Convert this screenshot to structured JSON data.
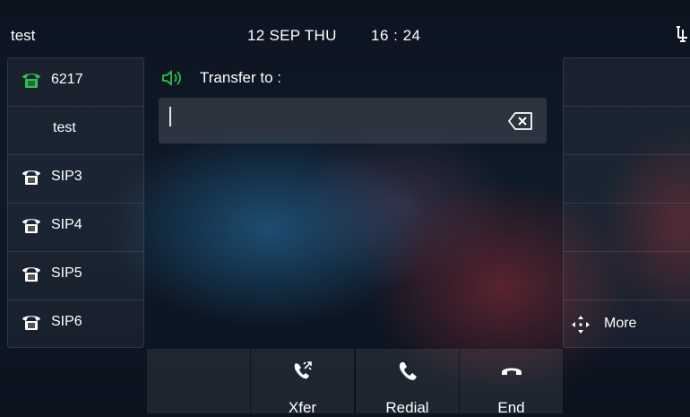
{
  "status": {
    "title": "test",
    "date": "12 SEP THU",
    "time": "16 : 24"
  },
  "lines": [
    {
      "label": "6217",
      "icon": "desk-phone-icon",
      "active": true
    },
    {
      "label": "test",
      "icon": ""
    },
    {
      "label": "SIP3",
      "icon": "desk-phone-icon"
    },
    {
      "label": "SIP4",
      "icon": "desk-phone-icon"
    },
    {
      "label": "SIP5",
      "icon": "desk-phone-icon"
    },
    {
      "label": "SIP6",
      "icon": "desk-phone-icon"
    }
  ],
  "transfer": {
    "label": "Transfer to :",
    "value": ""
  },
  "right_panel": {
    "more_label": "More"
  },
  "softkeys": [
    {
      "label": "",
      "icon": ""
    },
    {
      "label": "Xfer",
      "icon": "transfer-icon"
    },
    {
      "label": "Redial",
      "icon": "handset-icon"
    },
    {
      "label": "End",
      "icon": "hangup-icon"
    }
  ],
  "colors": {
    "accent_green": "#2ec44a",
    "background": "#0f1a28"
  }
}
